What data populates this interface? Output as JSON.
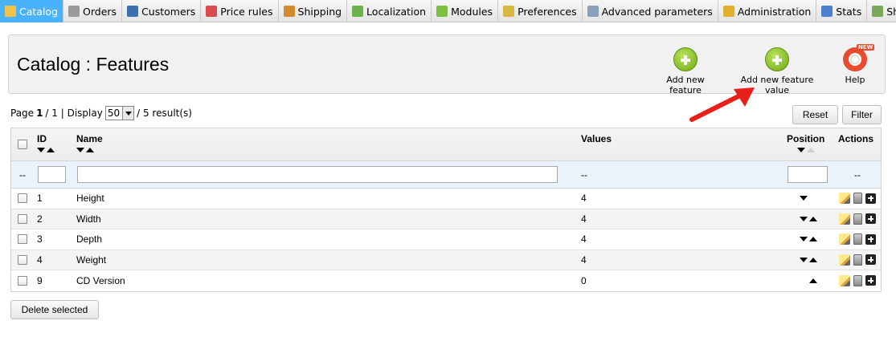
{
  "nav": {
    "tabs": [
      {
        "label": "Catalog",
        "icon": "folder-icon",
        "color": "#f1c24a"
      },
      {
        "label": "Orders",
        "icon": "cart-icon",
        "color": "#9a9a9a"
      },
      {
        "label": "Customers",
        "icon": "user-icon",
        "color": "#3c6fb0"
      },
      {
        "label": "Price rules",
        "icon": "price-tag-icon",
        "color": "#d94c4c"
      },
      {
        "label": "Shipping",
        "icon": "truck-icon",
        "color": "#d58a2c"
      },
      {
        "label": "Localization",
        "icon": "globe-icon",
        "color": "#6bb24a"
      },
      {
        "label": "Modules",
        "icon": "puzzle-icon",
        "color": "#7fbf3f"
      },
      {
        "label": "Preferences",
        "icon": "preferences-icon",
        "color": "#d9b740"
      },
      {
        "label": "Advanced parameters",
        "icon": "wrench-icon",
        "color": "#8aa0b8"
      },
      {
        "label": "Administration",
        "icon": "key-icon",
        "color": "#e0b02b"
      },
      {
        "label": "Stats",
        "icon": "bar-chart-icon",
        "color": "#4a7fd1"
      },
      {
        "label": "Shops",
        "icon": "shop-icon",
        "color": "#7aa85a"
      }
    ],
    "active_color": "#49b2ff"
  },
  "header": {
    "title": "Catalog : Features",
    "add_feature_label": "Add new feature",
    "add_feature_value_label": "Add new feature value",
    "help_label": "Help",
    "help_badge": "NEW"
  },
  "pagination": {
    "page_prefix": "Page",
    "page_current": "1",
    "page_total": "/ 1 | Display",
    "per_page": "50",
    "results": "/ 5 result(s)"
  },
  "buttons": {
    "reset": "Reset",
    "filter": "Filter",
    "delete_selected": "Delete selected"
  },
  "table": {
    "columns": {
      "id": "ID",
      "name": "Name",
      "values": "Values",
      "position": "Position",
      "actions": "Actions"
    },
    "filter_placeholder_dash": "--",
    "rows": [
      {
        "id": "1",
        "name": "Height",
        "values": "4",
        "down": true,
        "up": false
      },
      {
        "id": "2",
        "name": "Width",
        "values": "4",
        "down": true,
        "up": true
      },
      {
        "id": "3",
        "name": "Depth",
        "values": "4",
        "down": true,
        "up": true
      },
      {
        "id": "4",
        "name": "Weight",
        "values": "4",
        "down": true,
        "up": true
      },
      {
        "id": "9",
        "name": "CD Version",
        "values": "0",
        "down": false,
        "up": true
      }
    ]
  },
  "annotation": {
    "arrow_color": "#e8201c"
  }
}
